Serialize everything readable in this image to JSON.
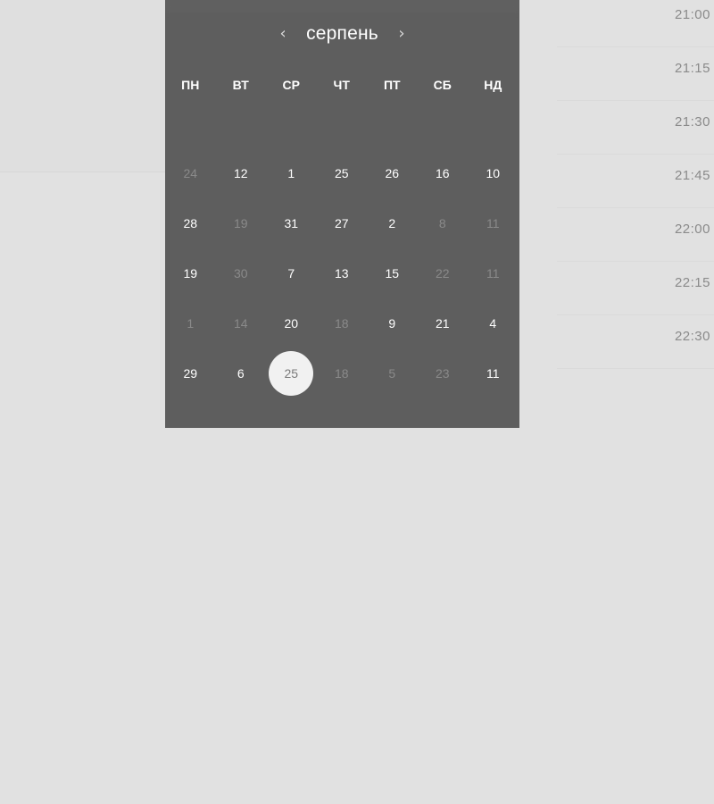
{
  "calendar": {
    "month": "серпень",
    "prev_icon": "chevron-left-icon",
    "next_icon": "chevron-right-icon",
    "weekdays": [
      "ПН",
      "ВТ",
      "СР",
      "ЧТ",
      "ПТ",
      "СБ",
      "НД"
    ],
    "rows": [
      [
        {
          "d": "24",
          "muted": true
        },
        {
          "d": "12",
          "muted": false
        },
        {
          "d": "1",
          "muted": false
        },
        {
          "d": "25",
          "muted": false
        },
        {
          "d": "26",
          "muted": false
        },
        {
          "d": "16",
          "muted": false
        },
        {
          "d": "10",
          "muted": false
        }
      ],
      [
        {
          "d": "28",
          "muted": false
        },
        {
          "d": "19",
          "muted": true
        },
        {
          "d": "31",
          "muted": false
        },
        {
          "d": "27",
          "muted": false
        },
        {
          "d": "2",
          "muted": false
        },
        {
          "d": "8",
          "muted": true
        },
        {
          "d": "11",
          "muted": true
        }
      ],
      [
        {
          "d": "19",
          "muted": false
        },
        {
          "d": "30",
          "muted": true
        },
        {
          "d": "7",
          "muted": false
        },
        {
          "d": "13",
          "muted": false
        },
        {
          "d": "15",
          "muted": false
        },
        {
          "d": "22",
          "muted": true
        },
        {
          "d": "11",
          "muted": true
        }
      ],
      [
        {
          "d": "1",
          "muted": true
        },
        {
          "d": "14",
          "muted": true
        },
        {
          "d": "20",
          "muted": false
        },
        {
          "d": "18",
          "muted": true
        },
        {
          "d": "9",
          "muted": false
        },
        {
          "d": "21",
          "muted": false
        },
        {
          "d": "4",
          "muted": false
        }
      ],
      [
        {
          "d": "29",
          "muted": false
        },
        {
          "d": "6",
          "muted": false
        },
        {
          "d": "25",
          "muted": false,
          "selected": true
        },
        {
          "d": "18",
          "muted": true
        },
        {
          "d": "5",
          "muted": true
        },
        {
          "d": "23",
          "muted": true
        },
        {
          "d": "11",
          "muted": false
        }
      ]
    ]
  },
  "times": [
    "21:00",
    "21:15",
    "21:30",
    "21:45",
    "22:00",
    "22:15",
    "22:30"
  ],
  "colors": {
    "background": "#e1e1e1",
    "calendar_bg": "#5e5e5e",
    "day_text": "#ffffff",
    "day_muted": "#8a8a8a",
    "selected_circle": "#f1f1f1",
    "time_text": "#8a8a8a"
  }
}
